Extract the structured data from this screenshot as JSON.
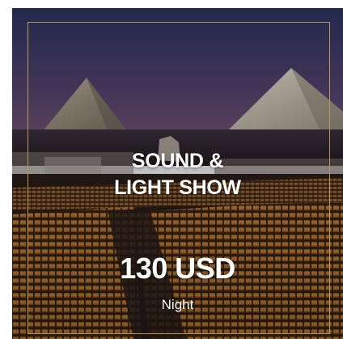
{
  "card": {
    "title_line1": "SOUND &",
    "title_line2": "LIGHT SHOW",
    "price": "130 USD",
    "period": "Night"
  },
  "theme": {
    "frame_color": "#b99a5a",
    "text_color": "#ffffff",
    "sky_top": "#2a3460",
    "sky_bottom": "#6c4e72",
    "seat_color": "#c8843a"
  },
  "icons": {
    "background": "pyramids-night-photo"
  }
}
